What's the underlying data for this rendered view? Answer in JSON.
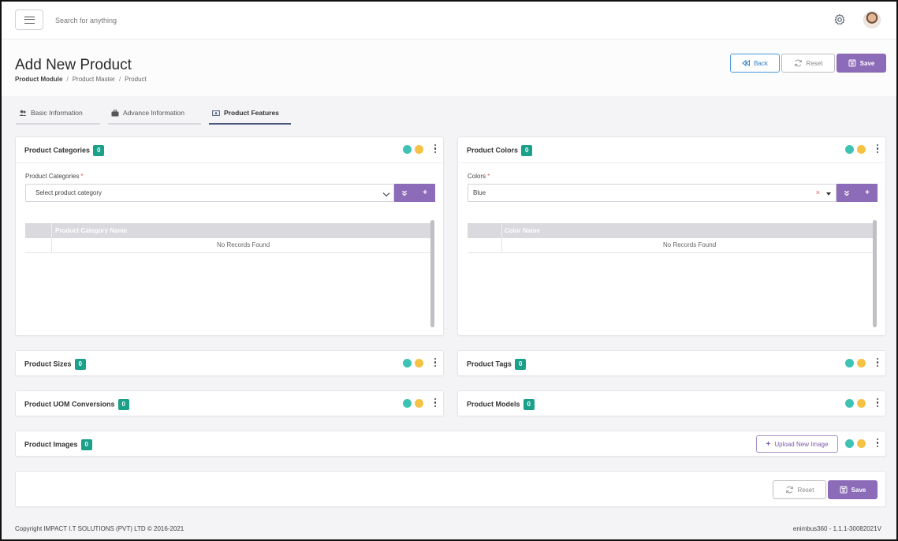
{
  "topbar": {
    "search_placeholder": "Search for anything"
  },
  "header": {
    "title": "Add New Product",
    "breadcrumb": [
      "Product Module",
      "Product Master",
      "Product"
    ],
    "back_label": "Back",
    "reset_label": "Reset",
    "save_label": "Save"
  },
  "tabs": [
    {
      "label": "Basic Information",
      "icon": "users-icon",
      "active": false
    },
    {
      "label": "Advance Information",
      "icon": "briefcase-icon",
      "active": false
    },
    {
      "label": "Product Features",
      "icon": "money-icon",
      "active": true
    }
  ],
  "categories": {
    "title": "Product Categories",
    "count": "0",
    "field_label": "Product Categories",
    "required_mark": "*",
    "placeholder": "Select product category",
    "column": "Product Category Name",
    "empty": "No Records Found"
  },
  "colors": {
    "title": "Product Colors",
    "count": "0",
    "field_label": "Colors",
    "required_mark": "*",
    "value": "Blue",
    "clear": "×",
    "column": "Color Name",
    "empty": "No Records Found"
  },
  "sizes": {
    "title": "Product Sizes",
    "count": "0"
  },
  "tags": {
    "title": "Product Tags",
    "count": "0"
  },
  "uom": {
    "title": "Product UOM Conversions",
    "count": "0"
  },
  "models": {
    "title": "Product Models",
    "count": "0"
  },
  "images": {
    "title": "Product Images",
    "count": "0",
    "upload_label": "Upload New Image"
  },
  "actions": {
    "reset_label": "Reset",
    "save_label": "Save"
  },
  "footer": {
    "copyright": "Copyright IMPACT I.T SOLUTIONS (PVT) LTD © 2016-2021",
    "version": "enimbus360 - 1.1.1-30082021V"
  },
  "colors_palette": {
    "accent": "#8c6bb8",
    "badge": "#1ba08a",
    "dot_teal": "#3cc3b3",
    "dot_amber": "#f6c244",
    "back": "#2f7fc4"
  }
}
